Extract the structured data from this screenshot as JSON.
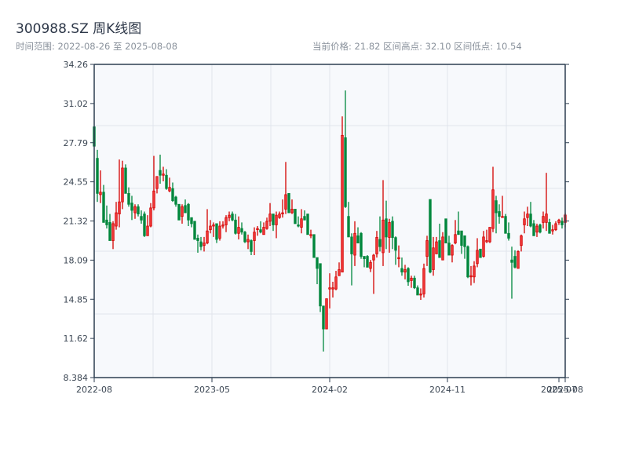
{
  "header": {
    "title": "300988.SZ 周K线图",
    "range_text": "时间范围: 2022-08-26 至 2025-08-08",
    "stats_text": "当前价格: 21.82  区间高点: 32.10  区间低点: 10.54"
  },
  "colors": {
    "up": "#d40000",
    "up_fill": "#f03a3a",
    "down": "#00873c",
    "plot_bg": "#f7f9fc",
    "axis": "#2d3e50",
    "grid": "#e1e5ec"
  },
  "chart_data": {
    "type": "candlestick",
    "title": "300988.SZ 周K线图",
    "start_date": "2022-08-26",
    "end_date": "2025-08-08",
    "ylim": [
      8.384,
      34.26
    ],
    "y_ticks": [
      "8.384",
      "11.62",
      "14.85",
      "18.09",
      "21.32",
      "24.55",
      "27.79",
      "31.02",
      "34.26"
    ],
    "x_ticks": [
      "2022-08",
      "2023-05",
      "2024-02",
      "2024-11",
      "2025-07",
      "2025-08"
    ],
    "grid": true,
    "candle_fields": [
      "open",
      "high",
      "low",
      "close"
    ],
    "candles": [
      [
        29.1,
        29.1,
        27.5,
        27.5
      ],
      [
        26.5,
        27.2,
        22.9,
        23.6
      ],
      [
        23.5,
        25.5,
        22.8,
        23.7
      ],
      [
        23.7,
        24.3,
        21.2,
        21.2
      ],
      [
        21.4,
        22.6,
        20.7,
        21.0
      ],
      [
        21.2,
        21.9,
        19.7,
        19.7
      ],
      [
        19.7,
        21.3,
        19.0,
        21.1
      ],
      [
        20.9,
        22.9,
        20.6,
        22.0
      ],
      [
        21.9,
        26.4,
        20.8,
        22.9
      ],
      [
        22.9,
        26.3,
        22.3,
        25.7
      ],
      [
        25.7,
        26.0,
        23.6,
        23.6
      ],
      [
        23.6,
        24.1,
        22.5,
        22.7
      ],
      [
        22.8,
        23.4,
        21.4,
        22.2
      ],
      [
        22.0,
        22.7,
        21.5,
        22.5
      ],
      [
        22.5,
        22.7,
        21.7,
        21.9
      ],
      [
        21.7,
        22.2,
        21.1,
        21.4
      ],
      [
        21.9,
        22.1,
        20.0,
        20.1
      ],
      [
        20.1,
        21.8,
        20.1,
        20.9
      ],
      [
        20.9,
        22.8,
        20.8,
        22.4
      ],
      [
        22.4,
        26.7,
        22.2,
        23.8
      ],
      [
        24.0,
        25.0,
        23.6,
        25.0
      ],
      [
        25.5,
        26.8,
        24.4,
        25.1
      ],
      [
        25.1,
        25.8,
        24.6,
        25.2
      ],
      [
        25.1,
        25.6,
        23.9,
        24.0
      ],
      [
        23.8,
        24.9,
        23.7,
        24.1
      ],
      [
        24.0,
        24.5,
        22.9,
        23.0
      ],
      [
        23.3,
        23.4,
        22.5,
        22.7
      ],
      [
        22.7,
        22.7,
        21.4,
        21.4
      ],
      [
        21.7,
        22.7,
        21.1,
        22.5
      ],
      [
        22.6,
        23.1,
        22.0,
        22.0
      ],
      [
        22.7,
        22.8,
        20.9,
        21.4
      ],
      [
        21.6,
        21.6,
        20.8,
        21.1
      ],
      [
        21.3,
        21.3,
        19.8,
        19.8
      ],
      [
        19.9,
        20.2,
        18.7,
        19.7
      ],
      [
        19.6,
        20.0,
        18.9,
        19.2
      ],
      [
        19.3,
        20.0,
        18.8,
        19.5
      ],
      [
        19.5,
        22.3,
        19.4,
        20.5
      ],
      [
        20.6,
        21.4,
        20.3,
        20.9
      ],
      [
        20.9,
        21.2,
        20.0,
        21.0
      ],
      [
        21.1,
        21.1,
        19.5,
        19.8
      ],
      [
        19.9,
        21.3,
        19.7,
        20.9
      ],
      [
        20.9,
        21.3,
        20.7,
        21.0
      ],
      [
        21.0,
        21.8,
        20.4,
        21.6
      ],
      [
        21.6,
        22.1,
        21.3,
        21.8
      ],
      [
        21.9,
        22.1,
        21.3,
        21.4
      ],
      [
        21.4,
        21.9,
        20.2,
        20.3
      ],
      [
        20.3,
        21.7,
        19.8,
        20.8
      ],
      [
        20.7,
        21.2,
        20.2,
        20.4
      ],
      [
        20.4,
        20.5,
        19.5,
        19.6
      ],
      [
        19.6,
        20.2,
        19.0,
        19.8
      ],
      [
        19.7,
        19.8,
        18.5,
        18.8
      ],
      [
        19.7,
        20.8,
        18.5,
        20.4
      ],
      [
        20.6,
        20.9,
        20.1,
        20.7
      ],
      [
        20.6,
        21.3,
        20.3,
        20.4
      ],
      [
        20.2,
        21.2,
        20.2,
        20.8
      ],
      [
        20.7,
        21.6,
        20.6,
        21.3
      ],
      [
        21.3,
        22.8,
        20.9,
        21.9
      ],
      [
        21.9,
        21.9,
        20.5,
        21.0
      ],
      [
        21.0,
        22.1,
        19.9,
        21.8
      ],
      [
        21.6,
        22.1,
        21.5,
        21.9
      ],
      [
        21.9,
        23.1,
        21.6,
        22.0
      ],
      [
        22.3,
        26.2,
        21.9,
        23.5
      ],
      [
        23.6,
        23.6,
        22.0,
        22.0
      ],
      [
        22.0,
        23.1,
        21.9,
        22.3
      ],
      [
        22.3,
        22.3,
        21.1,
        21.1
      ],
      [
        21.0,
        21.7,
        20.8,
        20.9
      ],
      [
        20.8,
        22.3,
        20.3,
        21.5
      ],
      [
        21.7,
        22.2,
        21.4,
        21.4
      ],
      [
        21.9,
        21.9,
        20.2,
        20.2
      ],
      [
        20.1,
        20.6,
        19.9,
        20.2
      ],
      [
        20.2,
        20.2,
        18.3,
        18.3
      ],
      [
        18.3,
        18.3,
        16.1,
        17.4
      ],
      [
        17.8,
        17.8,
        13.8,
        14.3
      ],
      [
        14.3,
        14.3,
        10.54,
        12.4
      ],
      [
        12.4,
        14.9,
        12.4,
        14.9
      ],
      [
        15.7,
        17.0,
        14.1,
        15.8
      ],
      [
        15.7,
        16.3,
        15.0,
        15.8
      ],
      [
        15.7,
        17.2,
        15.6,
        16.7
      ],
      [
        16.8,
        17.9,
        16.8,
        17.3
      ],
      [
        17.1,
        29.96,
        17.1,
        28.4
      ],
      [
        28.2,
        32.1,
        22.4,
        22.5
      ],
      [
        21.7,
        22.9,
        20.0,
        20.0
      ],
      [
        20.0,
        20.3,
        16.0,
        18.6
      ],
      [
        18.5,
        21.3,
        17.6,
        20.3
      ],
      [
        20.1,
        20.8,
        19.5,
        19.5
      ],
      [
        20.3,
        20.4,
        18.2,
        18.4
      ],
      [
        18.4,
        18.4,
        17.5,
        18.2
      ],
      [
        18.4,
        18.5,
        17.5,
        17.5
      ],
      [
        17.4,
        18.1,
        17.1,
        17.9
      ],
      [
        18.1,
        18.6,
        15.3,
        18.5
      ],
      [
        18.6,
        20.5,
        18.3,
        19.97
      ],
      [
        19.8,
        21.7,
        18.8,
        19.2
      ],
      [
        18.7,
        24.7,
        17.6,
        21.4
      ],
      [
        21.5,
        23.0,
        19.0,
        20.0
      ],
      [
        19.96,
        21.5,
        18.7,
        21.2
      ],
      [
        21.3,
        21.7,
        19.0,
        19.95
      ],
      [
        19.95,
        20.05,
        17.7,
        18.9
      ],
      [
        18.2,
        19.3,
        17.5,
        18.3
      ],
      [
        17.4,
        18.3,
        16.8,
        17.1
      ],
      [
        17.1,
        17.7,
        16.5,
        17.3
      ],
      [
        17.4,
        17.5,
        15.97,
        16.3
      ],
      [
        16.4,
        16.8,
        15.8,
        16.6
      ],
      [
        16.6,
        16.8,
        15.7,
        15.8
      ],
      [
        15.8,
        16.0,
        15.2,
        15.2
      ],
      [
        15.2,
        15.75,
        14.8,
        15.3
      ],
      [
        15.3,
        17.8,
        15.0,
        17.4
      ],
      [
        18.4,
        20.1,
        17.6,
        19.7
      ],
      [
        23.1,
        23.1,
        17.0,
        17.1
      ],
      [
        17.3,
        20.0,
        16.8,
        19.1
      ],
      [
        18.6,
        20.0,
        18.6,
        19.6
      ],
      [
        19.7,
        21.1,
        18.3,
        18.3
      ],
      [
        18.1,
        20.4,
        18.1,
        20.0
      ],
      [
        21.5,
        21.5,
        19.5,
        19.5
      ],
      [
        19.5,
        20.1,
        18.5,
        18.5
      ],
      [
        18.5,
        19.4,
        17.9,
        19.3
      ],
      [
        19.5,
        21.4,
        19.4,
        20.2
      ],
      [
        20.5,
        22.1,
        20.2,
        20.2
      ],
      [
        20.5,
        20.5,
        18.6,
        19.3
      ],
      [
        20.1,
        20.1,
        18.2,
        19.2
      ],
      [
        19.2,
        19.3,
        16.6,
        16.7
      ],
      [
        16.7,
        17.6,
        16.0,
        16.8
      ],
      [
        16.7,
        18.0,
        16.2,
        17.6
      ],
      [
        17.8,
        19.9,
        17.5,
        18.9
      ],
      [
        19.0,
        19.0,
        18.3,
        18.3
      ],
      [
        18.4,
        20.5,
        18.3,
        20.0
      ],
      [
        19.6,
        20.6,
        19.5,
        19.7
      ],
      [
        19.6,
        20.8,
        19.5,
        20.8
      ],
      [
        20.7,
        25.8,
        20.4,
        23.9
      ],
      [
        23.0,
        23.4,
        20.3,
        22.0
      ],
      [
        22.1,
        22.7,
        21.1,
        21.7
      ],
      [
        21.6,
        23.4,
        21.6,
        21.7
      ],
      [
        21.7,
        21.9,
        20.3,
        20.3
      ],
      [
        20.3,
        21.2,
        19.7,
        19.9
      ],
      [
        18.1,
        19.2,
        14.9,
        17.9
      ],
      [
        18.4,
        18.9,
        17.4,
        17.5
      ],
      [
        17.4,
        18.9,
        17.4,
        18.8
      ],
      [
        19.3,
        20.2,
        18.8,
        20.1
      ],
      [
        21.0,
        22.1,
        20.3,
        21.5
      ],
      [
        21.6,
        22.5,
        20.9,
        21.9
      ],
      [
        21.9,
        22.9,
        20.8,
        20.9
      ],
      [
        21.1,
        21.4,
        20.1,
        20.1
      ],
      [
        20.4,
        21.1,
        20.0,
        20.9
      ],
      [
        21.0,
        21.1,
        20.3,
        20.4
      ],
      [
        21.2,
        22.1,
        20.7,
        21.7
      ],
      [
        21.2,
        25.3,
        20.5,
        21.9
      ],
      [
        21.2,
        21.5,
        20.3,
        20.3
      ],
      [
        20.5,
        21.0,
        20.2,
        20.6
      ],
      [
        20.6,
        21.3,
        20.5,
        21.1
      ],
      [
        21.2,
        21.5,
        21.0,
        21.4
      ],
      [
        21.3,
        21.6,
        20.7,
        21.0
      ],
      [
        21.2,
        22.0,
        20.8,
        21.82
      ]
    ]
  }
}
